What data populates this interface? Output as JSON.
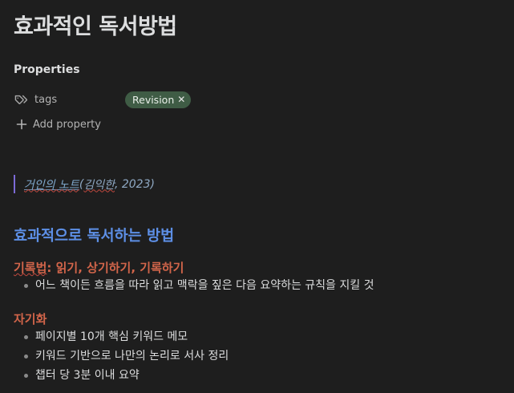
{
  "note": {
    "title": "효과적인 독서방법"
  },
  "properties": {
    "heading": "Properties",
    "tags": {
      "key": "tags",
      "icon": "tags-icon",
      "values": [
        "Revision"
      ],
      "tag_color": "#3f5c45"
    },
    "add_label": "Add property"
  },
  "quote": {
    "link_text": "거인의 노트",
    "citation_open": "(",
    "author": "김익한",
    "citation_rest": ", 2023)"
  },
  "section": {
    "heading": "효과적으로 독서하는 방법",
    "heading_color": "#5d8fe6"
  },
  "subsections": [
    {
      "heading_word": "기록법",
      "heading_rest": ": 읽기, 상기하기, 기록하기",
      "bullets": [
        "어느 책이든 흐름을 따라 읽고 맥락을 짚은 다음 요약하는 규칙을 지킬 것"
      ]
    },
    {
      "heading_word": "자기화",
      "heading_rest": "",
      "bullets": [
        "페이지별 10개 핵심 키워드 메모",
        "키워드 기반으로 나만의 논리로 서사 정리",
        "챕터 당 3분 이내 요약"
      ]
    }
  ],
  "colors": {
    "background": "#1e1e1e",
    "subheading": "#d2654a",
    "quote_bar": "#7c6ad6"
  }
}
